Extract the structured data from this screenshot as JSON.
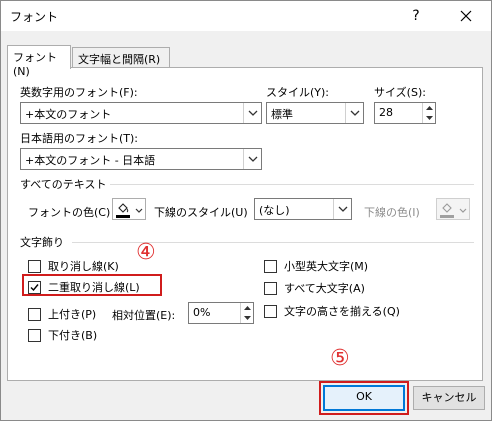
{
  "window": {
    "title": "フォント",
    "help": "?",
    "close_icon": "close-icon"
  },
  "tabs": [
    {
      "label": "フォント(N)",
      "active": true
    },
    {
      "label": "文字幅と間隔(R)",
      "active": false
    }
  ],
  "latin_font": {
    "label": "英数字用のフォント(F):",
    "value": "+本文のフォント"
  },
  "style": {
    "label": "スタイル(Y):",
    "value": "標準"
  },
  "size": {
    "label": "サイズ(S):",
    "value": "28"
  },
  "asian_font": {
    "label": "日本語用のフォント(T):",
    "value": "+本文のフォント - 日本語"
  },
  "all_text": {
    "heading": "すべてのテキスト",
    "font_color_label": "フォントの色(C)",
    "underline_style_label": "下線のスタイル(U)",
    "underline_style_value": "(なし)",
    "underline_color_label": "下線の色(I)"
  },
  "effects": {
    "heading": "文字飾り",
    "left": [
      {
        "label": "取り消し線(K)",
        "checked": false
      },
      {
        "label": "二重取り消し線(L)",
        "checked": true
      },
      {
        "label": "上付き(P)",
        "checked": false
      },
      {
        "label": "下付き(B)",
        "checked": false
      }
    ],
    "offset": {
      "label": "相対位置(E):",
      "value": "0%"
    },
    "right": [
      {
        "label": "小型英大文字(M)",
        "checked": false
      },
      {
        "label": "すべて大文字(A)",
        "checked": false
      },
      {
        "label": "文字の高さを揃える(Q)",
        "checked": false
      }
    ]
  },
  "buttons": {
    "ok": "OK",
    "cancel": "キャンセル"
  },
  "annotations": {
    "step4": "④",
    "step5": "⑤"
  },
  "colors": {
    "highlight_box": "#d01c1c",
    "default_button_border": "#0078d7"
  }
}
